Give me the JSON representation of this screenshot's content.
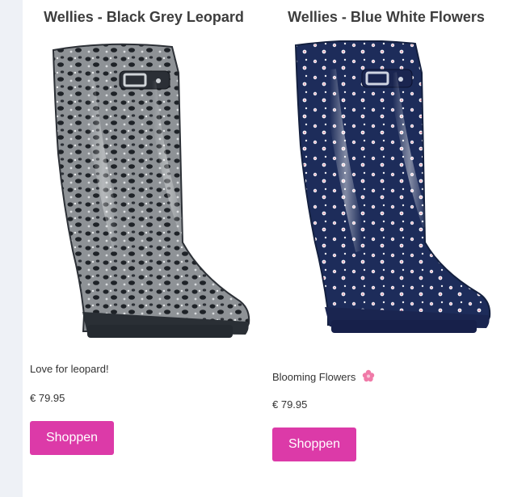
{
  "products": [
    {
      "title": "Wellies - Black Grey Leopard",
      "description": "Love for leopard!",
      "price": "€ 79.95",
      "button": "Shoppen",
      "image_icon": "leopard-welly-boot"
    },
    {
      "title": "Wellies - Blue White Flowers",
      "description": "Blooming Flowers",
      "price": "€ 79.95",
      "button": "Shoppen",
      "image_icon": "floral-welly-boot",
      "description_icon": "pink-flower-icon"
    }
  ],
  "colors": {
    "button": "#dc3aa8",
    "page_background": "#eef1f6",
    "panel_background": "#ffffff",
    "title_text": "#3d3d3d"
  }
}
